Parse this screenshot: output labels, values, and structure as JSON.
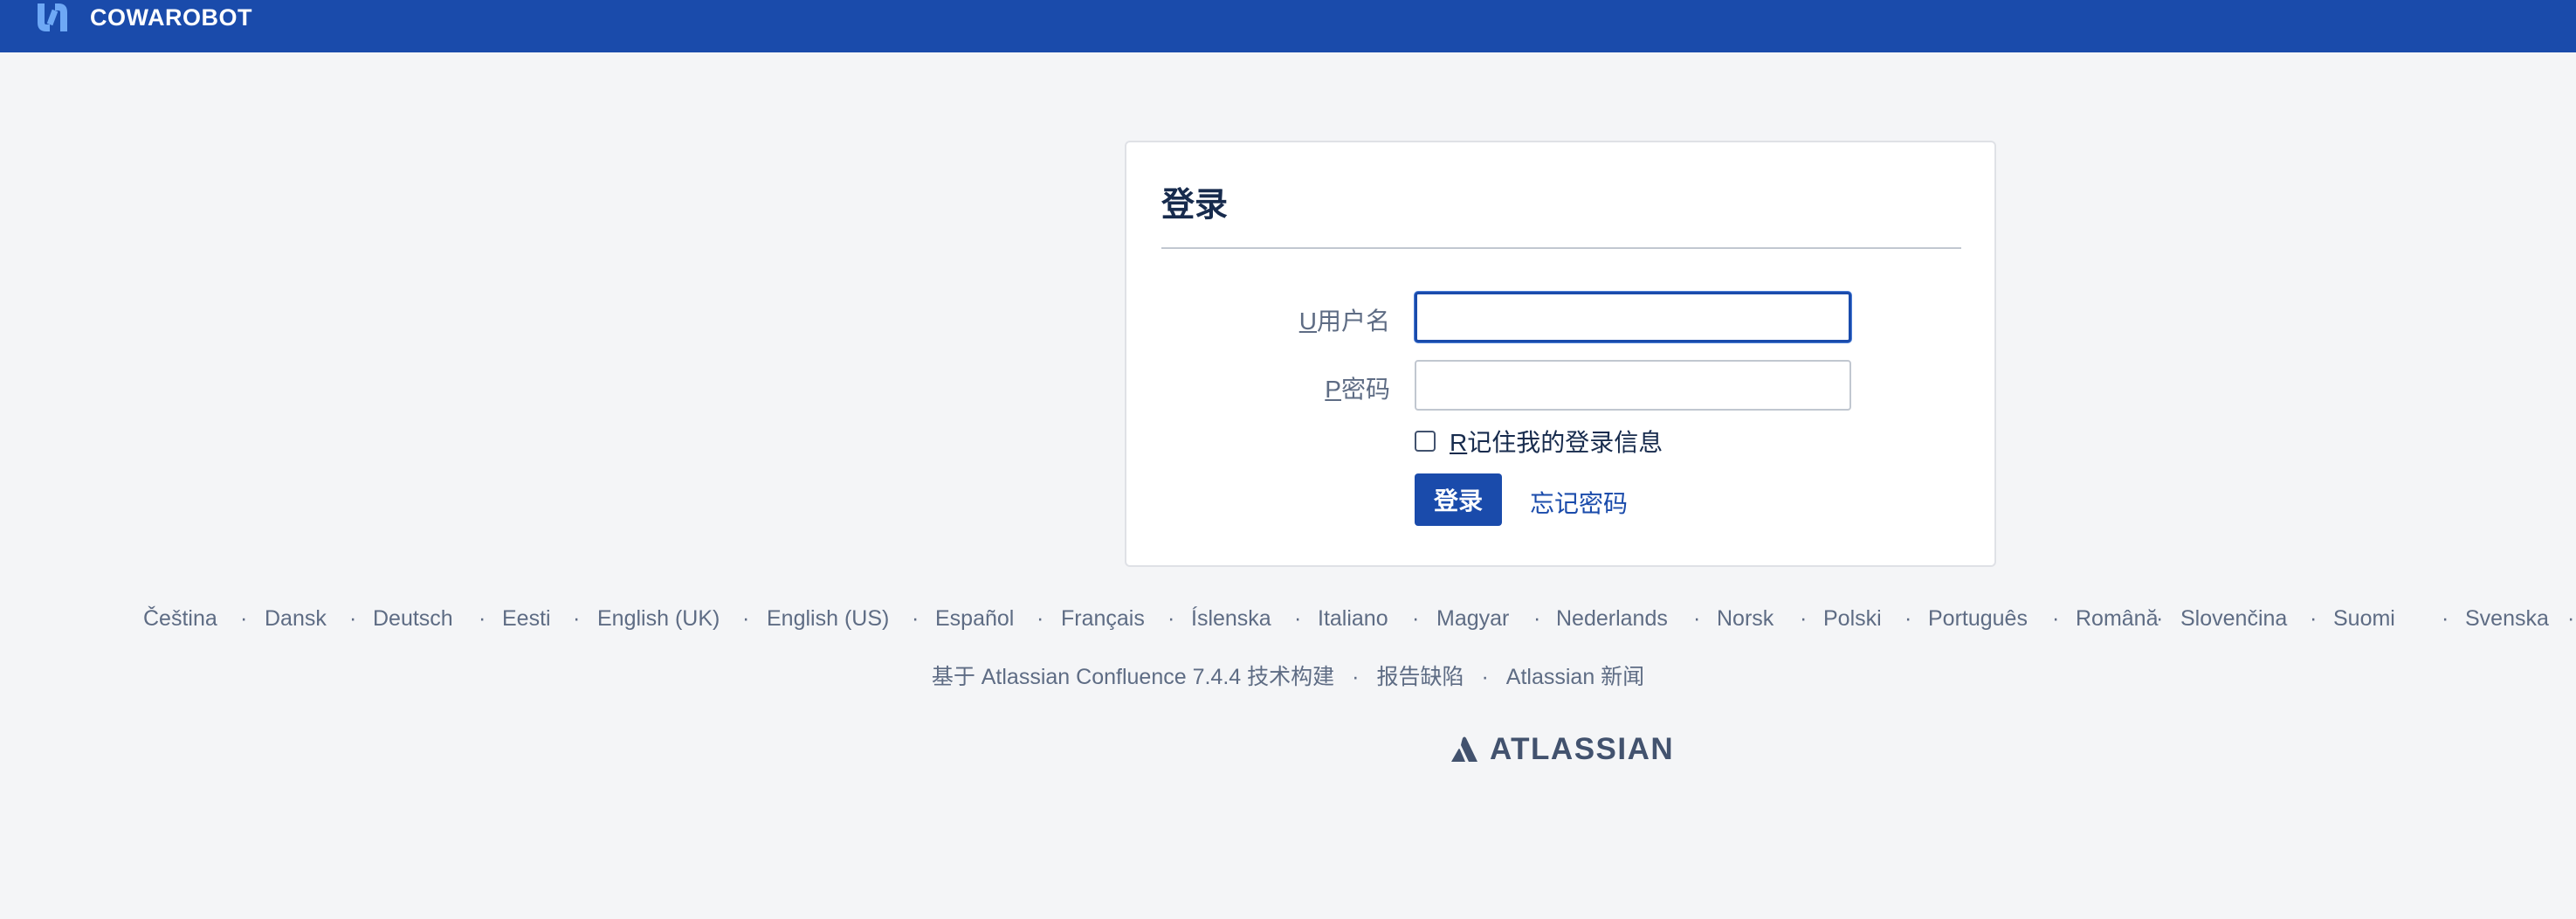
{
  "header": {
    "brand": "COWAROBOT",
    "logo_icon": "cowarobot-logo-icon",
    "accent": "#1a4bab"
  },
  "login": {
    "title": "登录",
    "username_accesskey": "U",
    "username_label": "用户名",
    "username_value": "",
    "password_accesskey": "P",
    "password_label": "密码",
    "password_value": "",
    "remember_accesskey": "R",
    "remember_label": "记住我的登录信息",
    "remember_checked": false,
    "submit_label": "登录",
    "forgot_label": "忘记密码"
  },
  "languages": [
    "Čeština",
    "Dansk",
    "Deutsch",
    "Eesti",
    "English (UK)",
    "English (US)",
    "Español",
    "Français",
    "Íslenska",
    "Italiano",
    "Magyar",
    "Nederlands",
    "Norsk",
    "Polski",
    "Português",
    "Română",
    "Slovenčina",
    "Suomi",
    "Svenska"
  ],
  "footer": {
    "powered_by": "基于 Atlassian Confluence 7.4.4 技术构建",
    "report_bug": "报告缺陷",
    "news": "Atlassian 新闻",
    "separator": "·",
    "atlassian_wordmark": "ATLASSIAN",
    "atlassian_icon": "atlassian-logo-icon"
  }
}
